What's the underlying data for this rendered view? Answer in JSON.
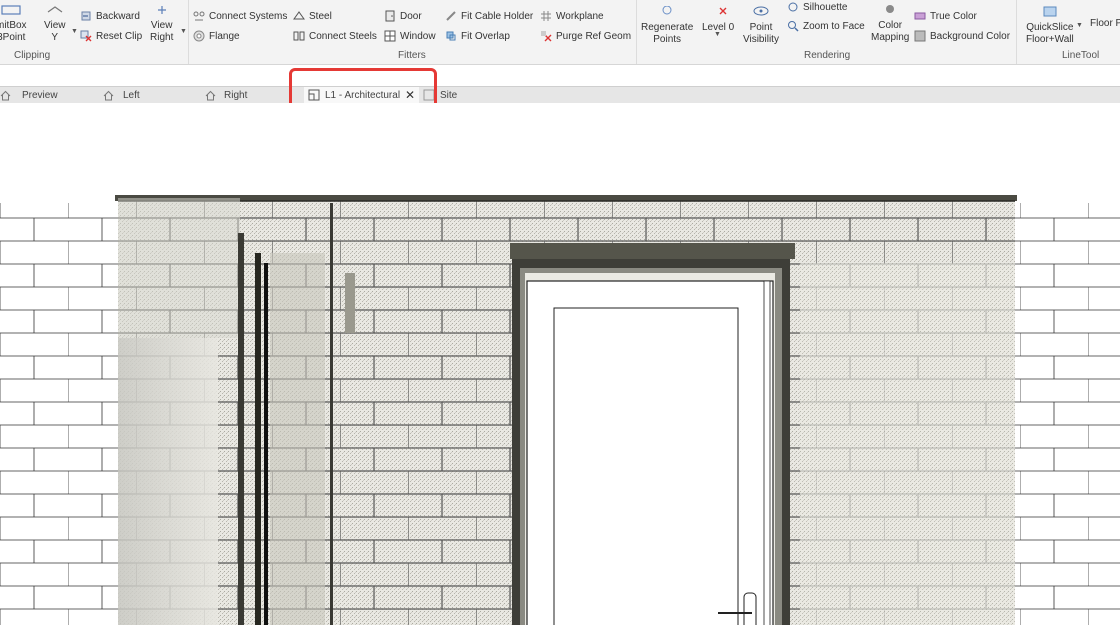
{
  "ribbon": {
    "clipping": {
      "label": "Clipping",
      "limitbox": "mitBox",
      "point": "3Point",
      "view_y_1": "View",
      "view_y_2": "Y",
      "backward": "Backward",
      "reset_clip": "Reset Clip",
      "view_right_1": "View",
      "view_right_2": "Right"
    },
    "fitters": {
      "label": "Fitters",
      "connect_systems": "Connect  Systems",
      "flange": "Flange",
      "steel": "Steel",
      "connect_steels": "Connect  Steels",
      "door": "Door",
      "window": "Window",
      "fit_cable_holder": "Fit Cable Holder",
      "fit_overlap": "Fit Overlap",
      "workplane": "Workplane",
      "purge_ref_geom": "Purge  Ref Geom"
    },
    "rendering": {
      "label": "Rendering",
      "regen_1": "Regenerate",
      "regen_2": "Points",
      "level": "Level 0",
      "point_vis_1": "Point",
      "point_vis_2": "Visibility",
      "silhouette": "Silhouette",
      "zoom_to_face": "Zoom to Face",
      "color_map_1": "Color",
      "color_map_2": "Mapping",
      "true_color": "True  Color",
      "background_color": "Background Color"
    },
    "linetool": {
      "label": "LineTool",
      "quickslice_1": "QuickSlice",
      "quickslice_2": "Floor+Wall",
      "floor_p": "Floor P"
    }
  },
  "tabs": {
    "preview": "Preview",
    "left": "Left",
    "right": "Right",
    "active": "L1 - Architectural",
    "site": "Site"
  },
  "colors": {
    "highlight": "#e53935",
    "ribbon_bg": "#f3f3f3",
    "tabbar_bg": "#e6e6e6"
  }
}
